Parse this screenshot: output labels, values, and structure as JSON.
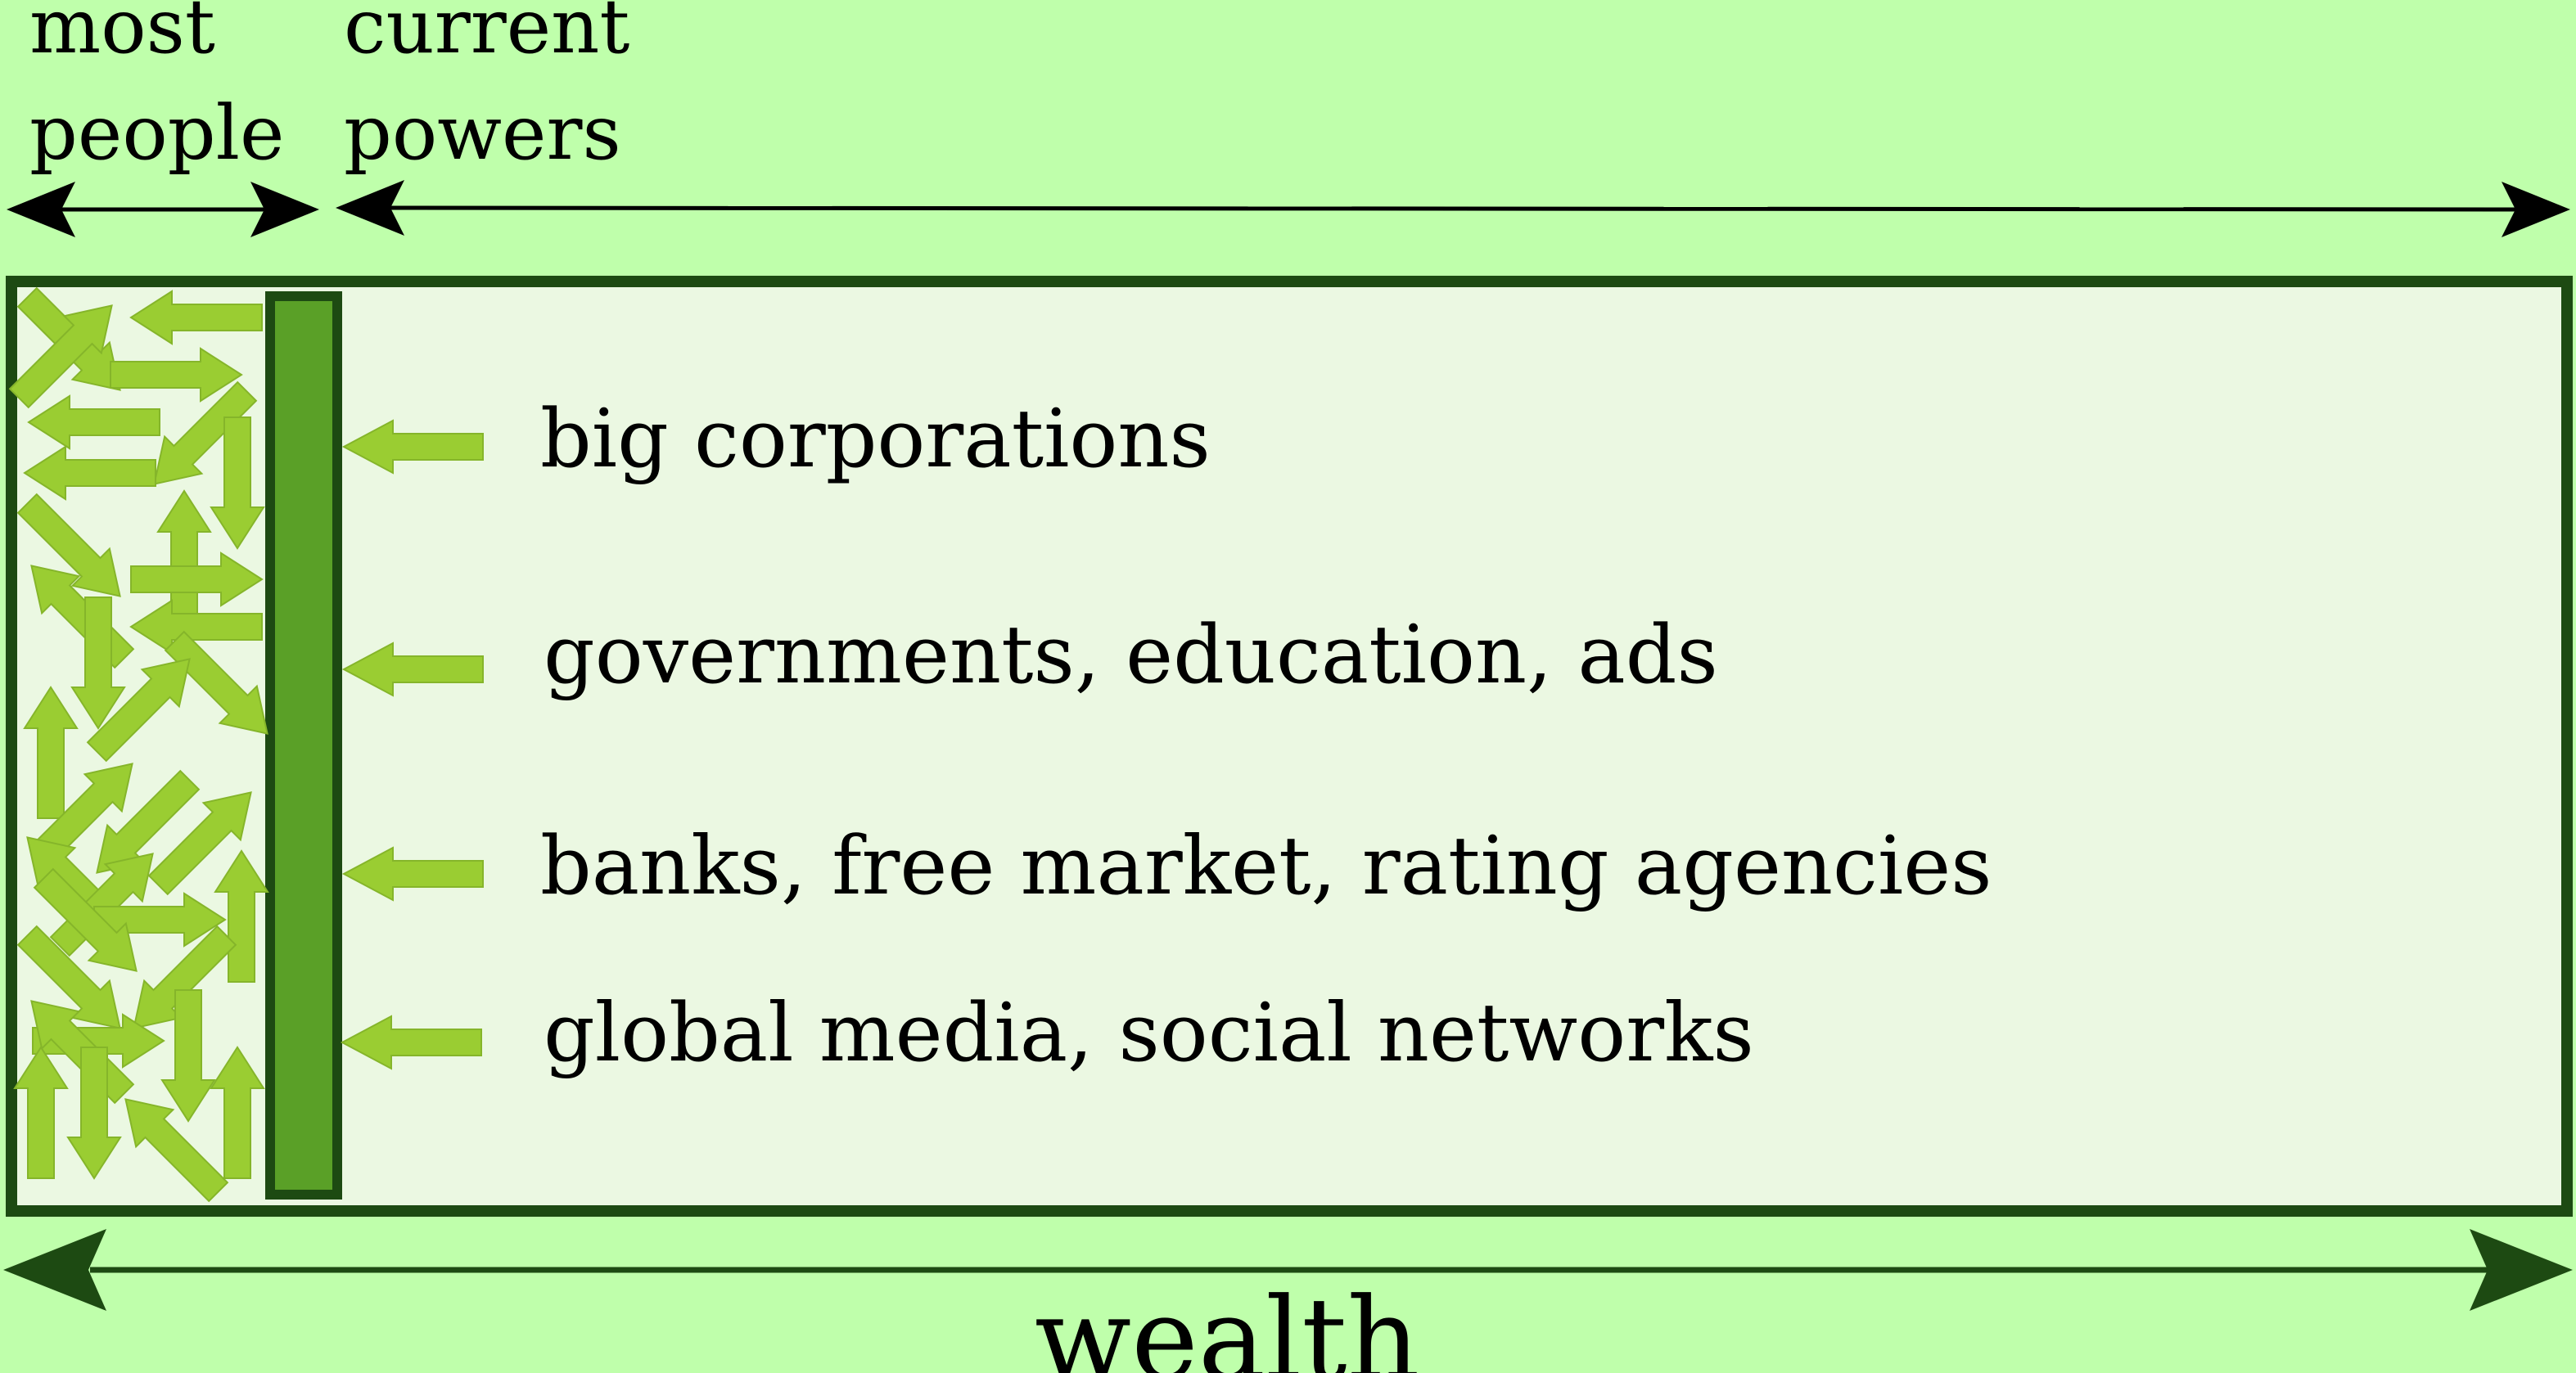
{
  "labels": {
    "most_people_line1": "most",
    "most_people_line2": "people",
    "current_powers_line1": "current",
    "current_powers_line2": "powers",
    "axis": "wealth"
  },
  "powers": [
    "big corporations",
    "governments, education, ads",
    "banks, free market, rating agencies",
    "global media, social networks"
  ],
  "colors": {
    "background": "#bfffab",
    "panel_fill": "#ebf8e2",
    "dark_green": "#1d4a12",
    "barrier_fill": "#5aa027",
    "small_arrow_fill": "#9acd32",
    "small_arrow_stroke": "#85b52a",
    "black": "#000000"
  }
}
